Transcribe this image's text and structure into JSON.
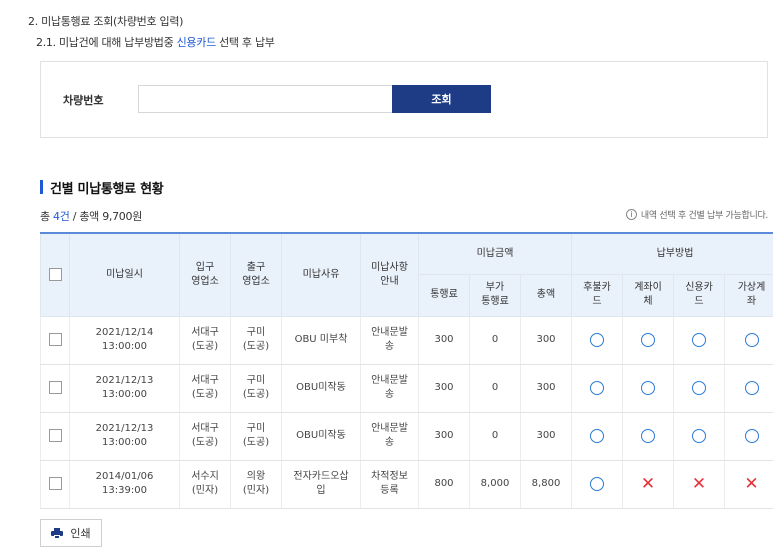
{
  "headings": {
    "step2": "2. 미납통행료 조회(차량번호 입력)",
    "step21_pre": "2.1. 미납건에 대해 납부방법중 ",
    "step21_highlight": "신용카드",
    "step21_post": " 선택 후 납부"
  },
  "search": {
    "label": "차량번호",
    "value": "",
    "placeholder": "",
    "button_label": "조회"
  },
  "section": {
    "title": "건별 미납통행료 현황"
  },
  "summary": {
    "prefix": "총 ",
    "count": "4건",
    "suffix": " / 총액 9,700원"
  },
  "notice": {
    "icon": "info-icon",
    "text": "내역 선택 후 건별 납부 가능합니다."
  },
  "table": {
    "headers": {
      "date": "미납일시",
      "entry": "입구\n영업소",
      "exit": "출구\n영업소",
      "reason": "미납사유",
      "guide": "미납사항\n안내",
      "amount_group": "미납금액",
      "toll": "통행료",
      "extra": "부가\n통행료",
      "total": "총액",
      "method_group": "납부방법",
      "deferred_card": "후불카\n드",
      "bank_transfer": "계좌이\n체",
      "credit_card": "신용카\n드",
      "virtual_account": "가상계\n좌"
    },
    "rows": [
      {
        "date": "2021/12/14 13:00:00",
        "entry": "서대구\n(도공)",
        "exit": "구미\n(도공)",
        "reason": "OBU 미부착",
        "guide": "안내문발\n송",
        "toll": "300",
        "extra": "0",
        "total": "300",
        "methods": [
          "available",
          "available",
          "available",
          "available"
        ]
      },
      {
        "date": "2021/12/13 13:00:00",
        "entry": "서대구\n(도공)",
        "exit": "구미\n(도공)",
        "reason": "OBU미작동",
        "guide": "안내문발\n송",
        "toll": "300",
        "extra": "0",
        "total": "300",
        "methods": [
          "available",
          "available",
          "available",
          "available"
        ]
      },
      {
        "date": "2021/12/13 13:00:00",
        "entry": "서대구\n(도공)",
        "exit": "구미\n(도공)",
        "reason": "OBU미작동",
        "guide": "안내문발\n송",
        "toll": "300",
        "extra": "0",
        "total": "300",
        "methods": [
          "available",
          "available",
          "available",
          "available"
        ]
      },
      {
        "date": "2014/01/06 13:39:00",
        "entry": "서수지\n(민자)",
        "exit": "의왕\n(민자)",
        "reason": "전자카드오삽\n입",
        "guide": "차적정보\n등록",
        "toll": "800",
        "extra": "8,000",
        "total": "8,800",
        "methods": [
          "available",
          "unavailable",
          "unavailable",
          "unavailable"
        ]
      }
    ]
  },
  "print": {
    "label": "인쇄",
    "icon": "printer-icon"
  },
  "colors": {
    "accent": "#1f5ad6",
    "button": "#1e3c86",
    "header_bg": "#e9f1fb",
    "available": "#2a7bd6",
    "unavailable": "#e5333a"
  }
}
